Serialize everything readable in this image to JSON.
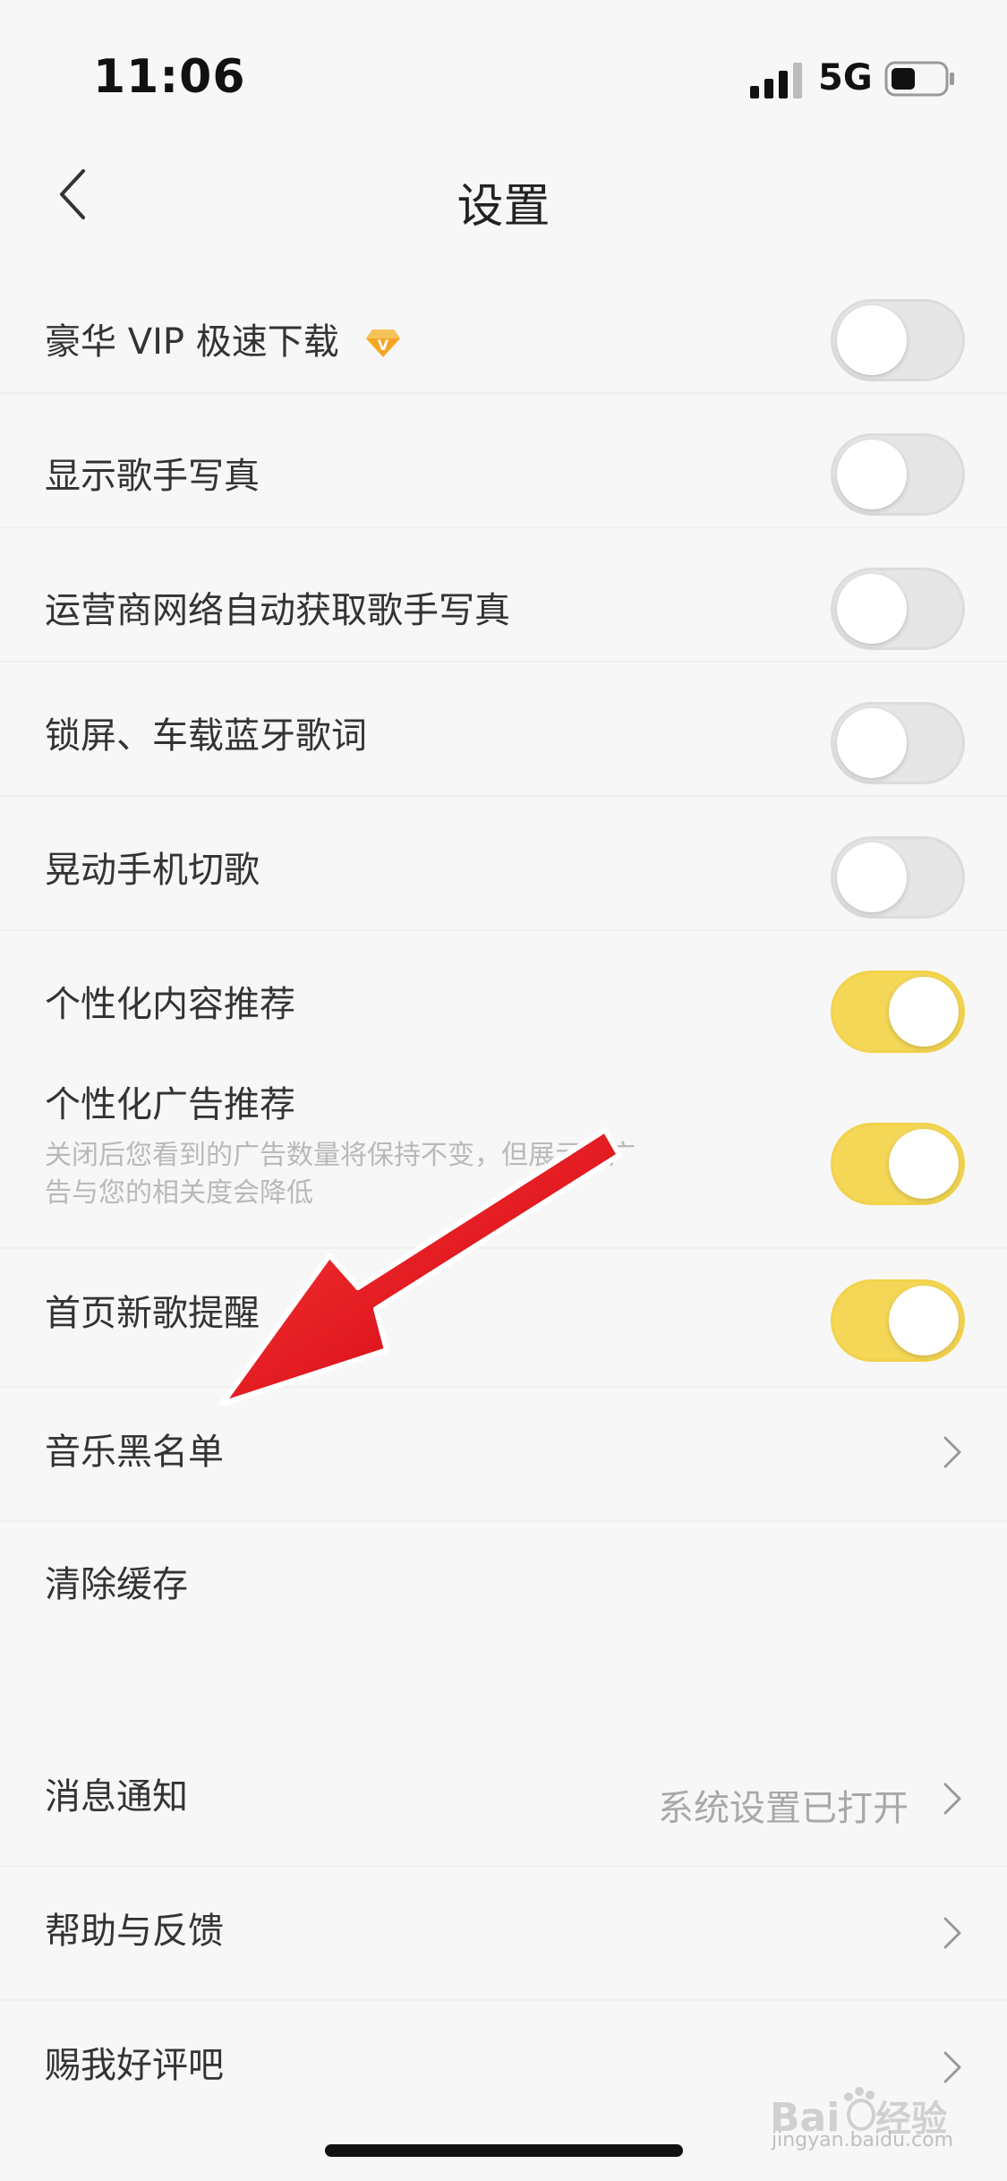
{
  "status": {
    "time": "11:06",
    "network": "5G"
  },
  "nav": {
    "title": "设置"
  },
  "settings": [
    {
      "label": "豪华 VIP 极速下载",
      "type": "toggle",
      "on": false
    },
    {
      "label": "显示歌手写真",
      "type": "toggle",
      "on": false
    },
    {
      "label": "运营商网络自动获取歌手写真",
      "type": "toggle",
      "on": false
    },
    {
      "label": "锁屏、车载蓝牙歌词",
      "type": "toggle",
      "on": false
    },
    {
      "label": "晃动手机切歌",
      "type": "toggle",
      "on": false
    },
    {
      "label": "个性化内容推荐",
      "type": "toggle",
      "on": true
    },
    {
      "label": "个性化广告推荐",
      "sub": "关闭后您看到的广告数量将保持不变，但展示的广告与您的相关度会降低",
      "type": "toggle",
      "on": true
    },
    {
      "label": "首页新歌提醒",
      "type": "toggle",
      "on": true
    },
    {
      "label": "音乐黑名单",
      "type": "link"
    },
    {
      "label": "清除缓存",
      "type": "plain"
    }
  ],
  "settings2": [
    {
      "label": "消息通知",
      "value": "系统设置已打开",
      "type": "link"
    },
    {
      "label": "帮助与反馈",
      "type": "link"
    },
    {
      "label": "赐我好评吧",
      "type": "link"
    }
  ],
  "watermark": {
    "text": "jingyan.baidu.com"
  },
  "colors": {
    "toggle_on": "#f4d756",
    "toggle_off": "#e6e6e6",
    "arrow": "#e8101a",
    "vip_badge": "#f5a623"
  }
}
